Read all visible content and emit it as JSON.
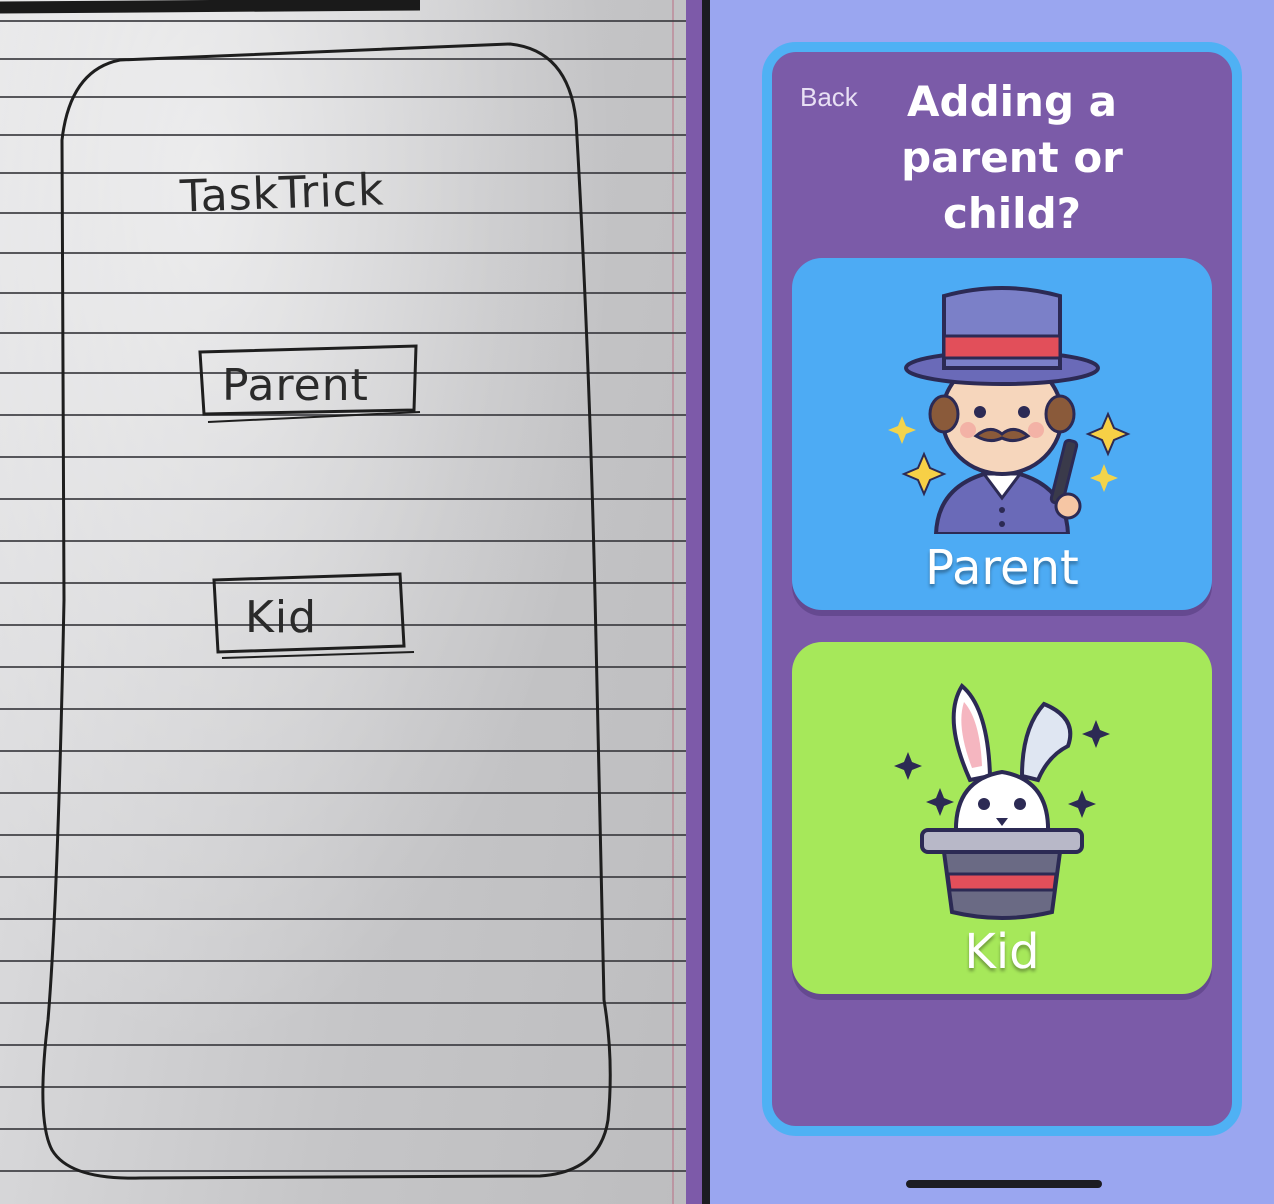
{
  "sketch": {
    "title": "TaskTrick",
    "parent_label": "Parent",
    "kid_label": "Kid"
  },
  "screen": {
    "back_label": "Back",
    "heading": "Adding a parent or child?",
    "options": [
      {
        "label": "Parent",
        "icon": "magician-icon",
        "color": "#4dabf4"
      },
      {
        "label": "Kid",
        "icon": "rabbit-in-hat-icon",
        "color": "#a6e85a"
      }
    ]
  },
  "colors": {
    "frame_background": "#7b5ba8",
    "frame_border": "#4fb1f4",
    "screen_background": "#9aa6f0"
  }
}
